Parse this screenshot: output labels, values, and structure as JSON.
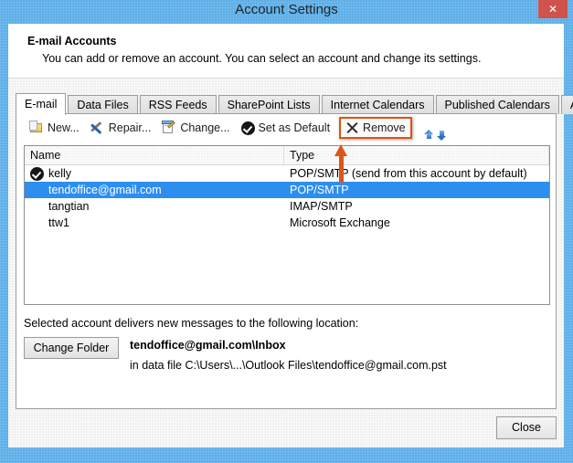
{
  "window": {
    "title": "Account Settings",
    "close_glyph": "✕",
    "close_icon_name": "close-icon"
  },
  "header": {
    "title": "E-mail Accounts",
    "subtitle": "You can add or remove an account. You can select an account and change its settings."
  },
  "tabs": [
    {
      "label": "E-mail",
      "active": true
    },
    {
      "label": "Data Files",
      "active": false
    },
    {
      "label": "RSS Feeds",
      "active": false
    },
    {
      "label": "SharePoint Lists",
      "active": false
    },
    {
      "label": "Internet Calendars",
      "active": false
    },
    {
      "label": "Published Calendars",
      "active": false
    },
    {
      "label": "Address Books",
      "active": false
    }
  ],
  "toolbar": {
    "new_label": "New...",
    "repair_label": "Repair...",
    "change_label": "Change...",
    "set_default_label": "Set as Default",
    "remove_label": "Remove",
    "move_up_title": "Move Up",
    "move_down_title": "Move Down",
    "highlight_color": "#E2520B"
  },
  "accounts_list": {
    "columns": [
      "Name",
      "Type"
    ],
    "rows": [
      {
        "name": "kelly",
        "type": "POP/SMTP (send from this account by default)",
        "is_default": true,
        "selected": false
      },
      {
        "name": "tendoffice@gmail.com",
        "type": "POP/SMTP",
        "is_default": false,
        "selected": true
      },
      {
        "name": "tangtian",
        "type": "IMAP/SMTP",
        "is_default": false,
        "selected": false
      },
      {
        "name": "ttw1",
        "type": "Microsoft Exchange",
        "is_default": false,
        "selected": false
      }
    ]
  },
  "delivery": {
    "label": "Selected account delivers new messages to the following location:",
    "change_folder_label": "Change Folder",
    "folder": "tendoffice@gmail.com\\Inbox",
    "data_file": "in data file C:\\Users\\...\\Outlook Files\\tendoffice@gmail.com.pst"
  },
  "footer": {
    "close_label": "Close"
  },
  "annotation": {
    "arrow_color": "#DD5519",
    "points_to": "Remove"
  }
}
